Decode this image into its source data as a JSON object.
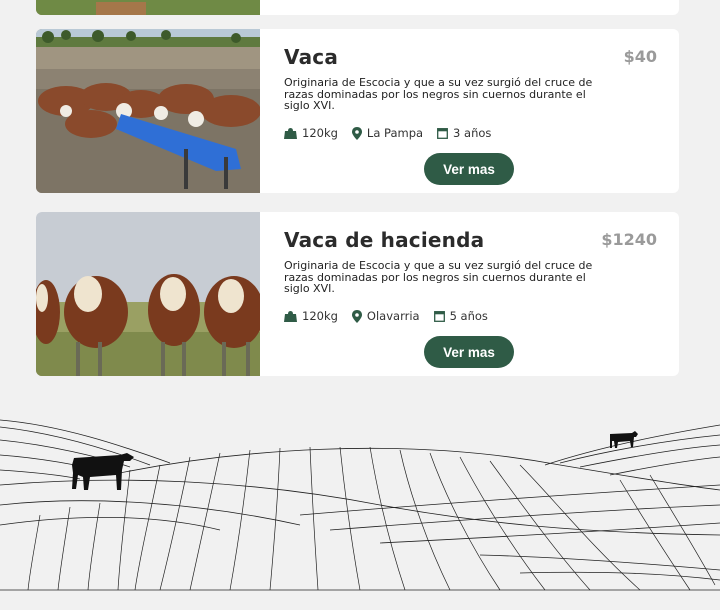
{
  "colors": {
    "accent": "#2f5b46",
    "background": "#f1f1f1",
    "card": "#ffffff",
    "price": "#9a9a9a"
  },
  "listings": [
    {
      "title": "Vaca",
      "price": "$40",
      "description": "Originaria de Escocia y que a su vez surgió del cruce de razas dominadas por los negros sin cuernos durante el siglo XVI.",
      "weight": "120kg",
      "location": "La Pampa",
      "age": "3 años",
      "button": "Ver mas",
      "image": "cattle-feeding-trough-photo"
    },
    {
      "title": "Vaca de hacienda",
      "price": "$1240",
      "description": "Originaria de Escocia y que a su vez surgió del cruce de razas dominadas por los negros sin cuernos durante el siglo XVI.",
      "weight": "120kg",
      "location": "Olavarria",
      "age": "5 años",
      "button": "Ver mas",
      "image": "hereford-cattle-field-photo"
    }
  ],
  "icons": {
    "weight": "weight-icon",
    "location": "location-pin-icon",
    "age": "calendar-icon"
  },
  "footer": {
    "illustration": "hills-with-cows-line-art"
  }
}
